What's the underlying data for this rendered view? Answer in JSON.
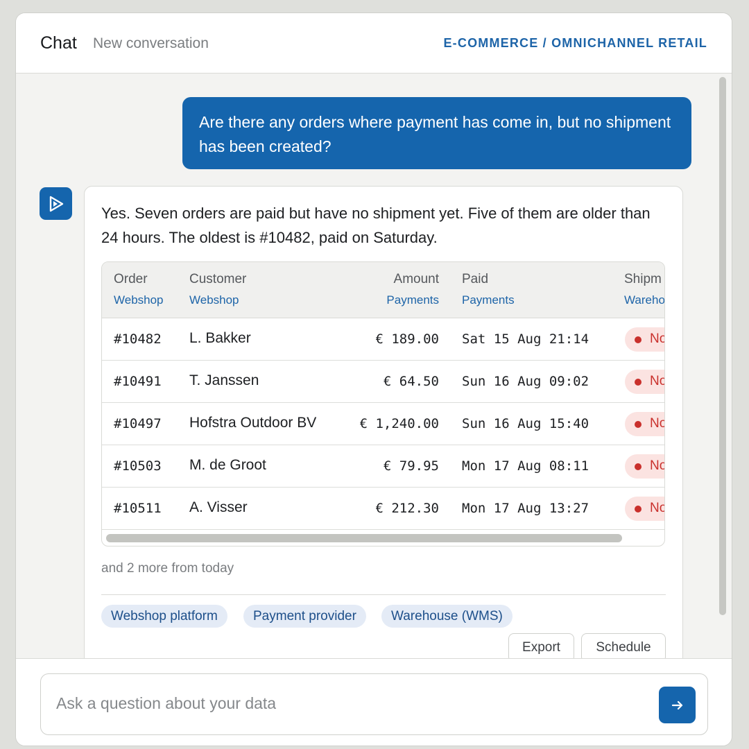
{
  "header": {
    "title": "Chat",
    "subtitle": "New conversation",
    "context": "E-COMMERCE / OMNICHANNEL RETAIL"
  },
  "user_message": "Are there any orders where payment has come in, but no shipment has been created?",
  "assistant": {
    "answer": "Yes. Seven orders are paid but have no shipment yet. Five of them are older than 24 hours. The oldest is #10482, paid on Saturday.",
    "table": {
      "columns": [
        {
          "label": "Order",
          "source": "Webshop"
        },
        {
          "label": "Customer",
          "source": "Webshop"
        },
        {
          "label": "Amount",
          "source": "Payments"
        },
        {
          "label": "Paid",
          "source": "Payments"
        },
        {
          "label": "Shipm",
          "source": "Wareho"
        }
      ],
      "rows": [
        {
          "order": "#10482",
          "customer": "L. Bakker",
          "amount": "€ 189.00",
          "paid": "Sat 15 Aug 21:14",
          "status": "No"
        },
        {
          "order": "#10491",
          "customer": "T. Janssen",
          "amount": "€ 64.50",
          "paid": "Sun 16 Aug 09:02",
          "status": "No"
        },
        {
          "order": "#10497",
          "customer": "Hofstra Outdoor BV",
          "amount": "€ 1,240.00",
          "paid": "Sun 16 Aug 15:40",
          "status": "No"
        },
        {
          "order": "#10503",
          "customer": "M. de Groot",
          "amount": "€ 79.95",
          "paid": "Mon 17 Aug 08:11",
          "status": "No"
        },
        {
          "order": "#10511",
          "customer": "A. Visser",
          "amount": "€ 212.30",
          "paid": "Mon 17 Aug 13:27",
          "status": "No"
        }
      ],
      "status_color": "#c9302c"
    },
    "more_text": "and 2 more from today",
    "sources": [
      "Webshop platform",
      "Payment provider",
      "Warehouse (WMS)"
    ],
    "actions": {
      "export": "Export",
      "schedule": "Schedule"
    }
  },
  "composer": {
    "placeholder": "Ask a question about your data",
    "send_icon": "arrow-right-icon"
  },
  "colors": {
    "accent": "#1565ad",
    "link": "#1d64a8",
    "chip_bg": "#e4ebf6",
    "status_bg": "#fbe3e1"
  }
}
